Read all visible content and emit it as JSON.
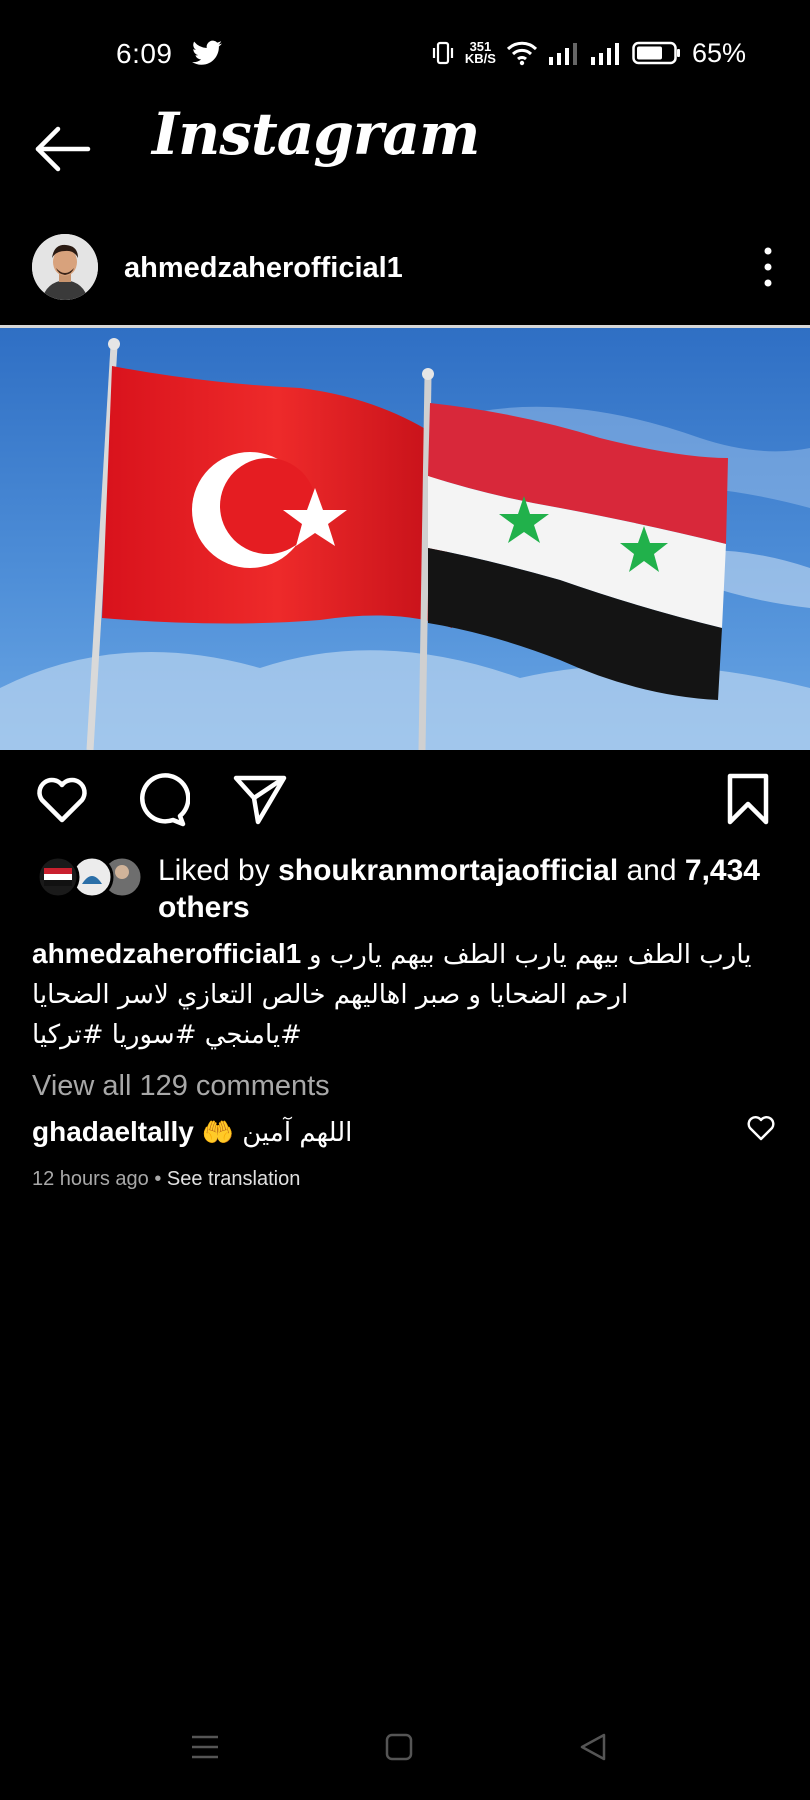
{
  "status_bar": {
    "time": "6:09",
    "net_speed_value": "351",
    "net_speed_unit": "KB/S",
    "battery_percent": "65%",
    "icons": [
      "twitter-icon",
      "vibrate-icon",
      "wifi-icon",
      "signal-icon",
      "signal-icon",
      "battery-icon"
    ]
  },
  "header": {
    "title": "Instagram"
  },
  "post": {
    "username": "ahmedzaherofficial1",
    "liked_by_prefix": "Liked by ",
    "liked_by_user": "shoukranmortajaofficial",
    "liked_by_and": " and ",
    "liked_by_count": "7,434",
    "liked_by_suffix": "others",
    "caption_user": "ahmedzaherofficial1",
    "caption_line1": "يارب الطف بيهم يارب الطف بيهم يارب و",
    "caption_line2": "ارحم الضحايا  و صبر اهاليهم خالص التعازي لاسر الضحايا",
    "caption_line3": "#يامنجي  #سوريا #تركيا",
    "view_all_comments": "View all 129 comments",
    "comment_user": "ghadaeltally",
    "comment_text": "اللهم آمين 🤲",
    "comment_time": "12 hours ago",
    "comment_separator": "•",
    "see_translation": "See translation"
  },
  "colors": {
    "background": "#000000",
    "text": "#ffffff",
    "muted": "#a8a8a8",
    "turkey_red": "#e30a17",
    "syria_red": "#d8283a",
    "syria_green": "#21b14b"
  }
}
